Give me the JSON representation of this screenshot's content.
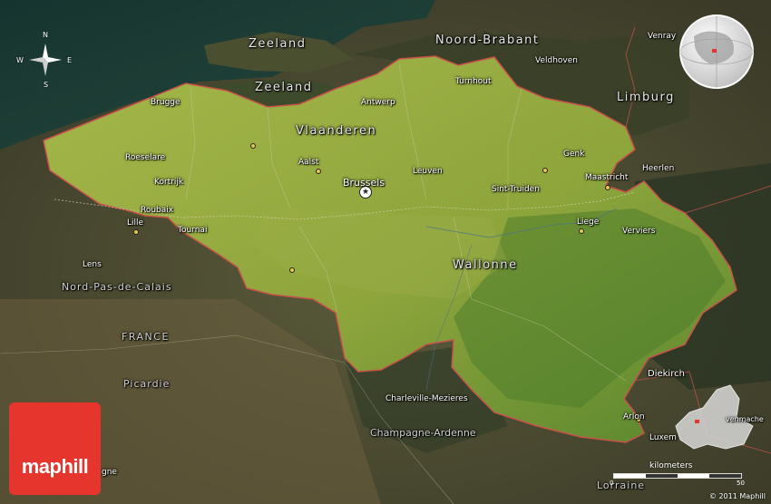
{
  "brand": {
    "logo_text": "maphill"
  },
  "compass": {
    "n": "N",
    "s": "S",
    "e": "E",
    "w": "W"
  },
  "regions": {
    "vlaanderen": "Vlaanderen",
    "wallonne": "Wallonne",
    "zeeland_1": "Zeeland",
    "zeeland_2": "Zeeland",
    "noord_brabant": "Noord-Brabant",
    "limburg": "Limburg",
    "nord_pas_de_calais": "Nord-Pas-de-Calais",
    "france": "FRANCE",
    "picardie": "Picardie",
    "champagne_ardenne": "Champagne-Ardenne",
    "lorraine": "Lorraine"
  },
  "cities": {
    "brugge": "Brugge",
    "antwerp": "Antwerp",
    "turnhout": "Turnhout",
    "roeselare": "Roeselare",
    "aalst": "Aalst",
    "brussels": "Brussels",
    "leuven": "Leuven",
    "genk": "Genk",
    "kortrijk": "Kortrijk",
    "roubaix": "Roubaix",
    "lille": "Lille",
    "tournai": "Tournai",
    "sint_truiden": "Sint-Truiden",
    "maastricht": "Maastricht",
    "heerlen": "Heerlen",
    "liege": "Liege",
    "verviers": "Verviers",
    "lens": "Lens",
    "charleville": "Charleville-Mezieres",
    "diekirch": "Diekirch",
    "arlon": "Arlon",
    "luxem": "Luxem",
    "venray": "Venray",
    "veldhoven": "Veldhoven",
    "gne": "gne",
    "venmache": "venmache"
  },
  "scale": {
    "label": "kilometers",
    "start": "0",
    "end": "50"
  },
  "copyright": "© 2011 Maphill",
  "colors": {
    "belgium": "#8fa63c",
    "border": "#c8524a",
    "sea": "#1d3a34",
    "brand": "#e5352c"
  }
}
